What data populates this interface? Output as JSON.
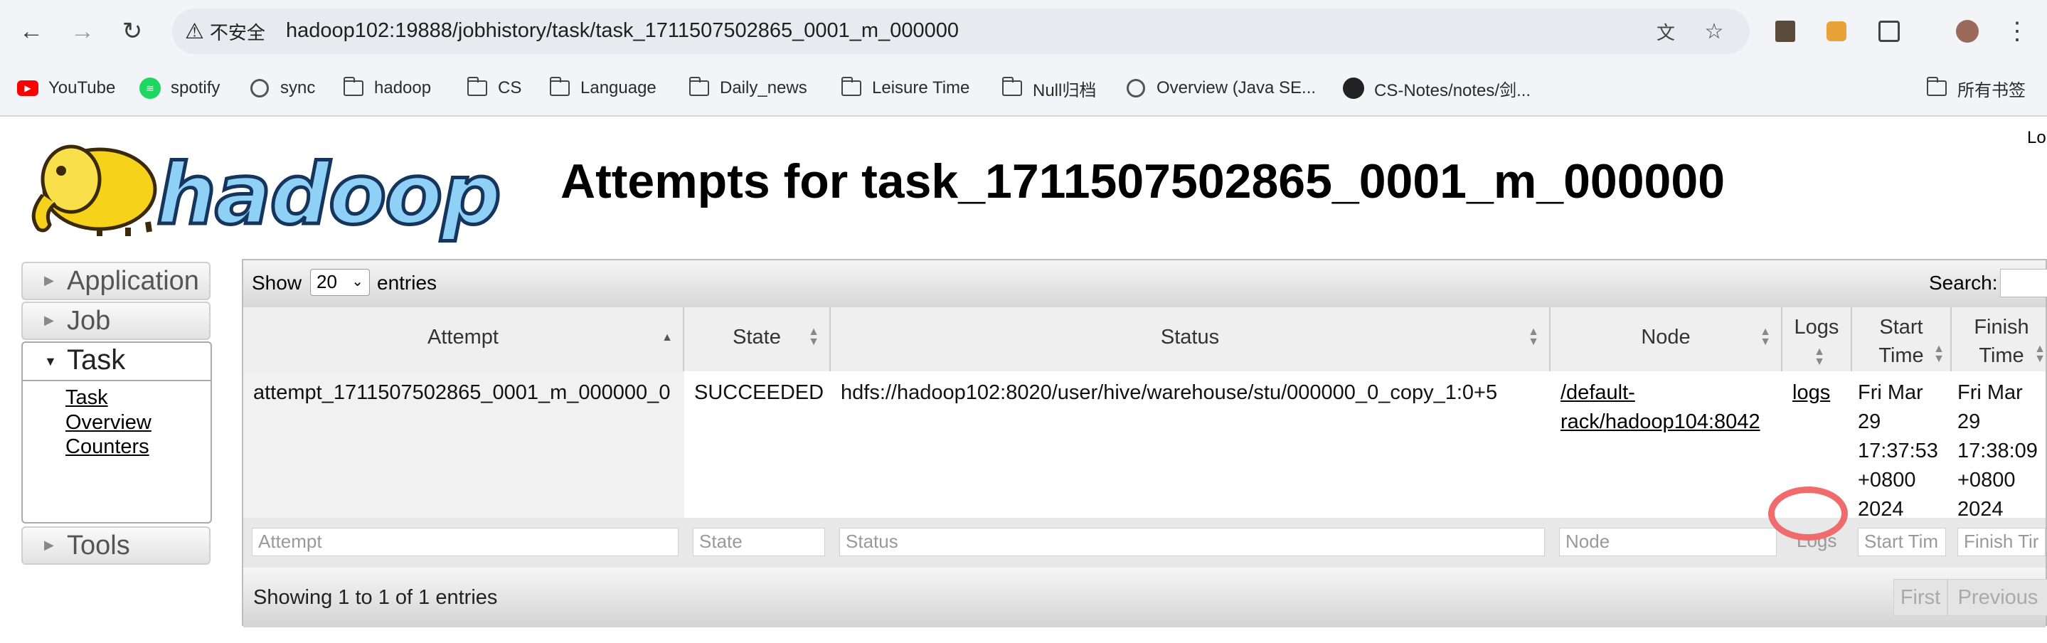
{
  "browser": {
    "back": "←",
    "forward": "→",
    "reload": "↻",
    "security_label": "不安全",
    "url": "hadoop102:19888/jobhistory/task/task_1711507502865_0001_m_000000",
    "translate_icon": "文",
    "star_icon": "☆",
    "menu_icon": "⋮"
  },
  "bookmarks": [
    {
      "label": "YouTube",
      "icon": "youtube-icon"
    },
    {
      "label": "spotify",
      "icon": "spotify-icon"
    },
    {
      "label": "sync",
      "icon": "globe-icon"
    },
    {
      "label": "hadoop",
      "icon": "folder-icon"
    },
    {
      "label": "CS",
      "icon": "folder-icon"
    },
    {
      "label": "Language",
      "icon": "folder-icon"
    },
    {
      "label": "Daily_news",
      "icon": "folder-icon"
    },
    {
      "label": "Leisure Time",
      "icon": "folder-icon"
    },
    {
      "label": "Null归档",
      "icon": "folder-icon"
    },
    {
      "label": "Overview (Java SE...",
      "icon": "globe-icon"
    },
    {
      "label": "CS-Notes/notes/剑...",
      "icon": "github-icon"
    }
  ],
  "all_bookmarks": "所有书签",
  "page": {
    "logo_text": "hadoop",
    "title": "Attempts for task_1711507502865_0001_m_000000",
    "login_partial": "Lo"
  },
  "nav": {
    "application": "Application",
    "job": "Job",
    "task": "Task",
    "task_links": [
      "Task Overview",
      "Counters"
    ],
    "tools": "Tools"
  },
  "table": {
    "show": "Show",
    "page_size": "20",
    "entries": "entries",
    "search": "Search:",
    "columns": {
      "attempt": "Attempt",
      "state": "State",
      "status": "Status",
      "node": "Node",
      "logs": "Logs",
      "start_time_1": "Start",
      "start_time_2": "Time",
      "finish_time_1": "Finish",
      "finish_time_2": "Time"
    },
    "row": {
      "attempt": "attempt_1711507502865_0001_m_000000_0",
      "state": "SUCCEEDED",
      "status": "hdfs://hadoop102:8020/user/hive/warehouse/stu/000000_0_copy_1:0+5",
      "node_1": "/default-",
      "node_2": "rack/hadoop104:8042",
      "logs": "logs",
      "start": [
        "Fri Mar",
        "29",
        "17:37:53",
        "+0800",
        "2024"
      ],
      "finish": [
        "Fri Mar",
        "29",
        "17:38:09",
        "+0800",
        "2024"
      ]
    },
    "filters": {
      "attempt": "Attempt",
      "state": "State",
      "status": "Status",
      "node": "Node",
      "logs": "Logs",
      "start": "Start Tim",
      "finish": "Finish Tir"
    },
    "info": "Showing 1 to 1 of 1 entries",
    "first": "First",
    "previous": "Previous"
  },
  "colors": {
    "highlight_circle": "#f06b6b",
    "logo_fill": "#8fd0f6",
    "logo_stroke": "#15355c"
  }
}
